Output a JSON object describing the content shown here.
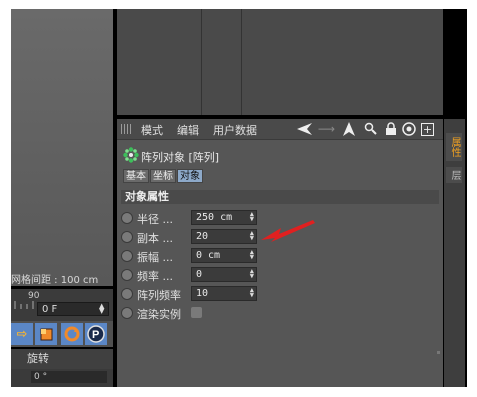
{
  "left_panel": {
    "grid_spacing_label": "网格间距 : 100 cm",
    "timeline_tick": "90",
    "frame_value": "0 F",
    "rotate_label": "旋转",
    "bottom_value": "0 °"
  },
  "toolbar_icons": [
    "arrow-icon",
    "cube-icon",
    "refresh-icon",
    "p-icon"
  ],
  "attributes": {
    "menu": [
      "模式",
      "编辑",
      "用户数据"
    ],
    "object_title": "阵列对象 [阵列]",
    "tabs": [
      "基本",
      "坐标",
      "对象"
    ],
    "active_tab": "对象",
    "section_title": "对象属性",
    "rows": [
      {
        "label": "半径 ...",
        "value": "250 cm"
      },
      {
        "label": "副本 ...",
        "value": "20"
      },
      {
        "label": "振幅 ...",
        "value": "0 cm"
      },
      {
        "label": "频率 ...",
        "value": "0"
      },
      {
        "label": "阵列频率",
        "value": "10"
      }
    ],
    "render_instances_label": "渲染实例"
  },
  "side_tabs": [
    "属性",
    "层"
  ],
  "colors": {
    "panel_bg": "#565656",
    "active_tab": "#8da9c9",
    "annotation_arrow": "#e02020",
    "side_tab_text": "#f0a020"
  }
}
